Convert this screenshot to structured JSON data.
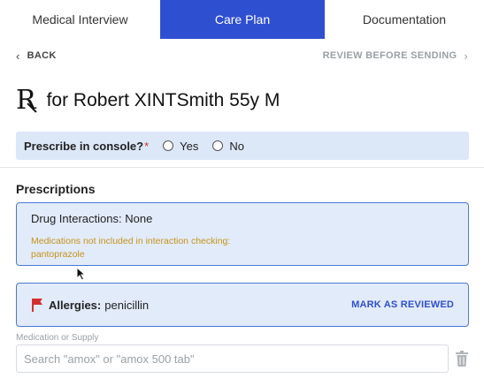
{
  "tabs": [
    {
      "label": "Medical Interview",
      "active": false
    },
    {
      "label": "Care Plan",
      "active": true
    },
    {
      "label": "Documentation",
      "active": false
    }
  ],
  "nav": {
    "back_label": "BACK",
    "review_label": "REVIEW BEFORE SENDING",
    "back_icon": "chevron-left-icon",
    "review_icon": "chevron-right-icon"
  },
  "header": {
    "rx_symbol": "R",
    "title": "for Robert XINTSmith 55y M"
  },
  "console": {
    "label": "Prescribe in console?",
    "required_mark": "*",
    "options": [
      "Yes",
      "No"
    ],
    "selected": null
  },
  "prescriptions": {
    "section_title": "Prescriptions",
    "interactions_title": "Drug Interactions: None",
    "interactions_note": "Medications not included in interaction checking:",
    "interactions_note_items": "pantoprazole"
  },
  "allergies": {
    "label": "Allergies:",
    "value": "penicillin",
    "action_label": "MARK AS REVIEWED",
    "icon": "flag-icon"
  },
  "medication_field": {
    "label": "Medication or Supply",
    "placeholder": "Search \"amox\" or \"amox 500 tab\"",
    "value": "",
    "delete_icon": "trash-icon"
  },
  "colors": {
    "accent": "#2f4fd1",
    "panel_bg": "#e2ebfa",
    "panel_border": "#4a78d6",
    "warning_text": "#c5931a",
    "flag": "#d32f2f"
  }
}
